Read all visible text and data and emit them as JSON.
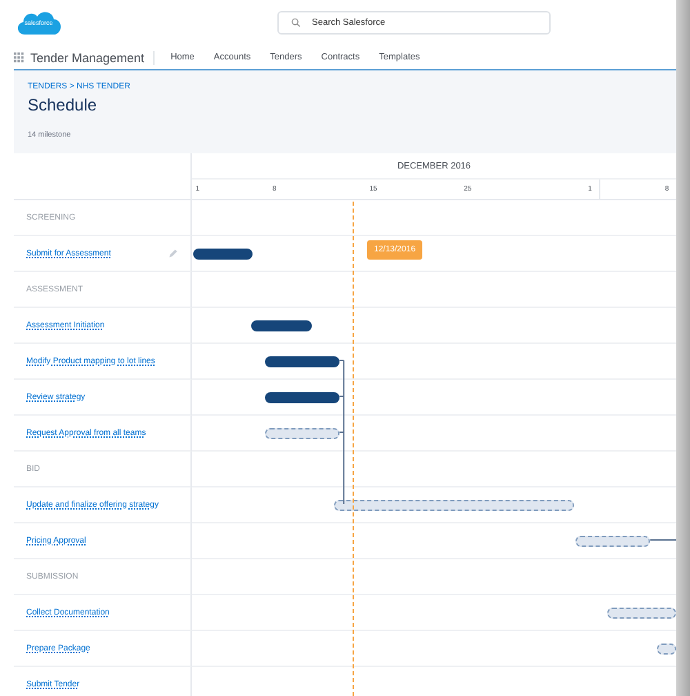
{
  "logo": {
    "text": "salesforce"
  },
  "search": {
    "placeholder": "Search Salesforce"
  },
  "app": {
    "name": "Tender Management",
    "nav": [
      {
        "label": "Home",
        "selected": false
      },
      {
        "label": "Accounts",
        "selected": false
      },
      {
        "label": "Tenders",
        "selected": false
      },
      {
        "label": "Contracts",
        "selected": false
      },
      {
        "label": "Templates",
        "selected": false
      }
    ]
  },
  "header": {
    "breadcrumb": "TENDERS > NHS TENDER",
    "title": "Schedule",
    "subtitle": "14 milestone"
  },
  "timeline": {
    "month": "DECEMBER 2016",
    "ticks": [
      "1",
      "8",
      "15",
      "25",
      "1",
      "8"
    ],
    "today": "12/13/2016"
  },
  "rows": [
    {
      "kind": "phase",
      "label": "SCREENING"
    },
    {
      "kind": "task",
      "label": "Submit for Assessment",
      "editable": true,
      "bar": {
        "planned": false
      }
    },
    {
      "kind": "phase",
      "label": "ASSESSMENT"
    },
    {
      "kind": "task",
      "label": "Assessment Initiation",
      "editable": false,
      "bar": {
        "planned": false
      }
    },
    {
      "kind": "task",
      "label": "Modify Product mapping to lot lines",
      "editable": false,
      "bar": {
        "planned": false
      }
    },
    {
      "kind": "task",
      "label": "Review strategy",
      "editable": false,
      "bar": {
        "planned": false
      }
    },
    {
      "kind": "task",
      "label": "Request Approval from all teams",
      "editable": false,
      "bar": {
        "planned": true
      }
    },
    {
      "kind": "phase",
      "label": "BID"
    },
    {
      "kind": "task",
      "label": "Update and finalize offering strategy",
      "editable": false,
      "bar": {
        "planned": true
      }
    },
    {
      "kind": "task",
      "label": "Pricing Approval",
      "editable": false,
      "bar": {
        "planned": true
      }
    },
    {
      "kind": "phase",
      "label": "SUBMISSION"
    },
    {
      "kind": "task",
      "label": "Collect Documentation",
      "editable": false,
      "bar": {
        "planned": true
      }
    },
    {
      "kind": "task",
      "label": "Prepare Package",
      "editable": false,
      "bar": {
        "planned": true
      }
    },
    {
      "kind": "task",
      "label": "Submit Tender",
      "editable": false
    }
  ]
}
